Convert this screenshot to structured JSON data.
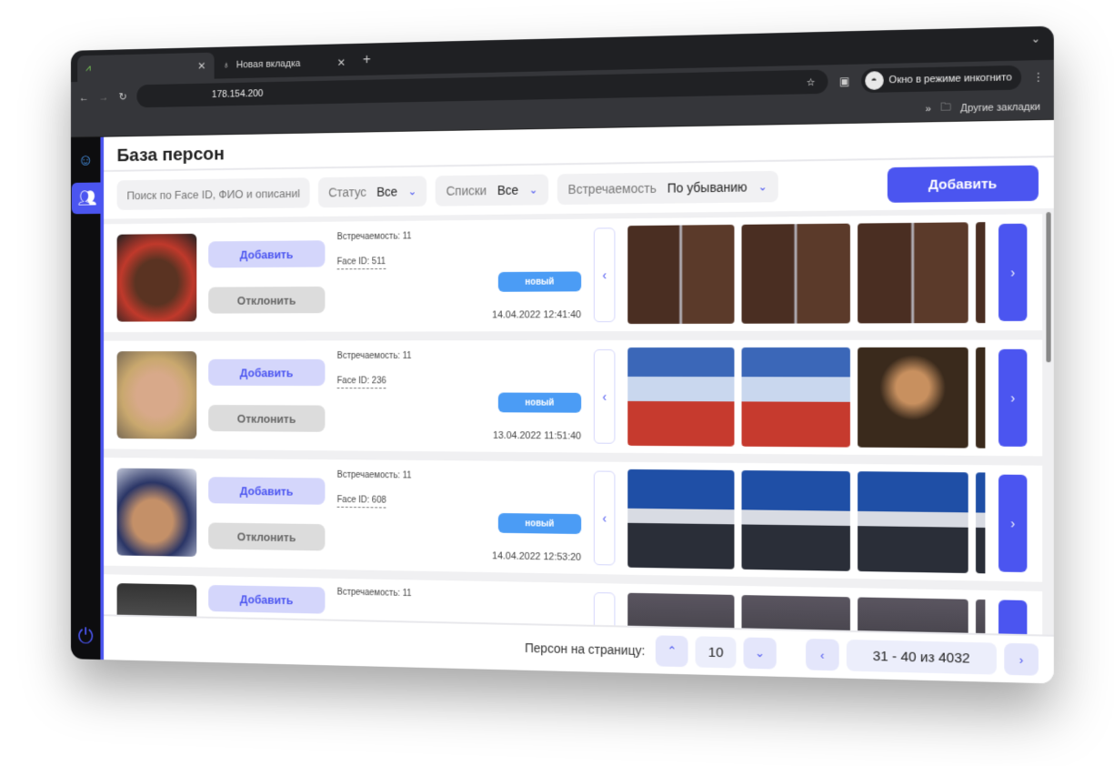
{
  "browser": {
    "tabs": [
      {
        "label": ""
      },
      {
        "label": "Новая вкладка"
      }
    ],
    "url": "178.154.200",
    "incognito_label": "Окно в режиме инкогнито",
    "bookmarks_label": "Другие закладки"
  },
  "page": {
    "title": "База персон",
    "search_placeholder": "Поиск по Face ID, ФИО и описаниk",
    "filters": [
      {
        "label": "Статус",
        "value": "Все"
      },
      {
        "label": "Списки",
        "value": "Все"
      },
      {
        "label": "Встречаемость",
        "value": "По убыванию"
      }
    ],
    "add_label": "Добавить"
  },
  "persons": [
    {
      "occurrence": "Встречаемость: 11",
      "face_id": "Face ID: 511",
      "status": "новый",
      "date": "14.04.2022 12:41:40",
      "add": "Добавить",
      "reject": "Отклонить"
    },
    {
      "occurrence": "Встречаемость: 11",
      "face_id": "Face ID: 236",
      "status": "новый",
      "date": "13.04.2022 11:51:40",
      "add": "Добавить",
      "reject": "Отклонить"
    },
    {
      "occurrence": "Встречаемость: 11",
      "face_id": "Face ID: 608",
      "status": "новый",
      "date": "14.04.2022 12:53:20",
      "add": "Добавить",
      "reject": "Отклонить"
    },
    {
      "occurrence": "Встречаемость: 11",
      "add": "Добавить"
    }
  ],
  "pagination": {
    "per_page_label": "Персон на страницу:",
    "per_page": "10",
    "range": "31 - 40 из 4032"
  },
  "colors": {
    "accent": "#4b55f0",
    "badge": "#4b9cf5"
  }
}
